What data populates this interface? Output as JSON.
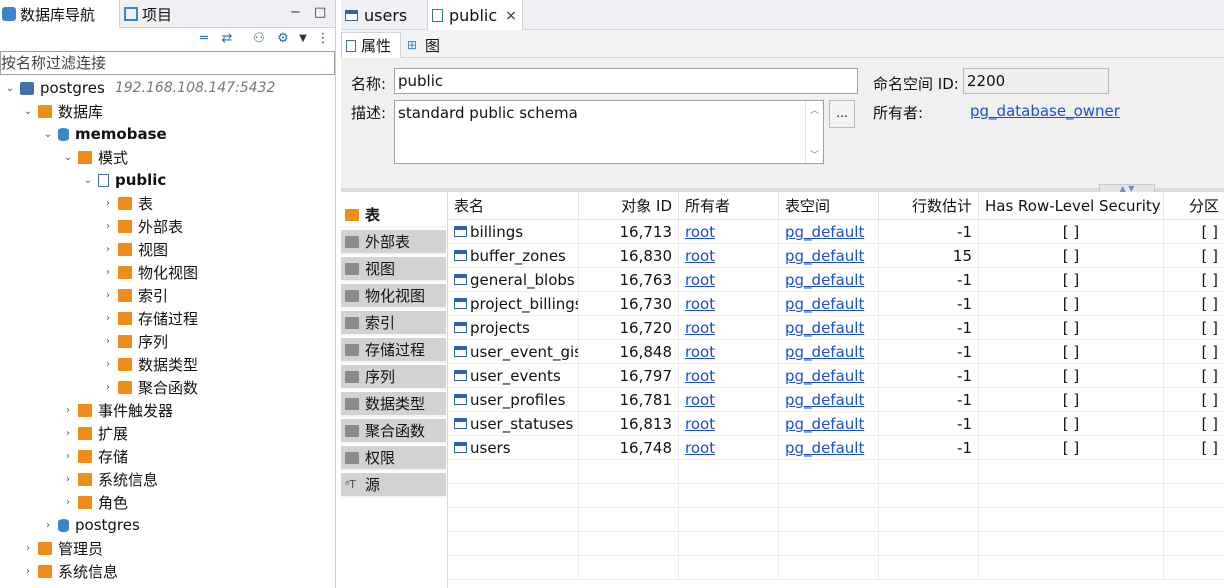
{
  "nav": {
    "tabs": [
      {
        "label": "数据库导航",
        "icon": "database-nav-icon"
      },
      {
        "label": "项目",
        "icon": "project-icon"
      }
    ],
    "minimize": "−",
    "maximize": "□",
    "filter_placeholder": "按名称过滤连接",
    "tree": {
      "connection": {
        "label": "postgres",
        "host": "192.168.108.147:5432"
      },
      "databases_label": "数据库",
      "db": {
        "label": "memobase"
      },
      "schemas_label": "模式",
      "schema": {
        "label": "public"
      },
      "schema_children": [
        "表",
        "外部表",
        "视图",
        "物化视图",
        "索引",
        "存储过程",
        "序列",
        "数据类型",
        "聚合函数"
      ],
      "db_children": [
        "事件触发器",
        "扩展",
        "存储",
        "系统信息",
        "角色"
      ],
      "other_db": "postgres",
      "admin": "管理员",
      "sysinfo": "系统信息"
    }
  },
  "editor": {
    "tabs": [
      {
        "label": "users"
      },
      {
        "label": "public",
        "close": "×"
      }
    ],
    "subtabs": [
      {
        "label": "属性"
      },
      {
        "label": "图"
      }
    ],
    "props": {
      "name_label": "名称:",
      "name_value": "public",
      "desc_label": "描述:",
      "desc_value": "standard public schema",
      "dots": "...",
      "ns_label": "命名空间 ID:",
      "ns_value": "2200",
      "owner_label": "所有者:",
      "owner_value": "pg_database_owner"
    },
    "folders": [
      "表",
      "外部表",
      "视图",
      "物化视图",
      "索引",
      "存储过程",
      "序列",
      "数据类型",
      "聚合函数",
      "权限",
      "源"
    ],
    "columns": [
      "表名",
      "对象 ID",
      "所有者",
      "表空间",
      "行数估计",
      "Has Row-Level Security",
      "分区"
    ],
    "rows": [
      {
        "name": "billings",
        "oid": "16,713",
        "owner": "root",
        "tablespace": "pg_default",
        "rows": "-1",
        "rls": "[ ]",
        "part": "[ ]"
      },
      {
        "name": "buffer_zones",
        "oid": "16,830",
        "owner": "root",
        "tablespace": "pg_default",
        "rows": "15",
        "rls": "[ ]",
        "part": "[ ]"
      },
      {
        "name": "general_blobs",
        "oid": "16,763",
        "owner": "root",
        "tablespace": "pg_default",
        "rows": "-1",
        "rls": "[ ]",
        "part": "[ ]"
      },
      {
        "name": "project_billings",
        "oid": "16,730",
        "owner": "root",
        "tablespace": "pg_default",
        "rows": "-1",
        "rls": "[ ]",
        "part": "[ ]"
      },
      {
        "name": "projects",
        "oid": "16,720",
        "owner": "root",
        "tablespace": "pg_default",
        "rows": "-1",
        "rls": "[ ]",
        "part": "[ ]"
      },
      {
        "name": "user_event_gists",
        "oid": "16,848",
        "owner": "root",
        "tablespace": "pg_default",
        "rows": "-1",
        "rls": "[ ]",
        "part": "[ ]"
      },
      {
        "name": "user_events",
        "oid": "16,797",
        "owner": "root",
        "tablespace": "pg_default",
        "rows": "-1",
        "rls": "[ ]",
        "part": "[ ]"
      },
      {
        "name": "user_profiles",
        "oid": "16,781",
        "owner": "root",
        "tablespace": "pg_default",
        "rows": "-1",
        "rls": "[ ]",
        "part": "[ ]"
      },
      {
        "name": "user_statuses",
        "oid": "16,813",
        "owner": "root",
        "tablespace": "pg_default",
        "rows": "-1",
        "rls": "[ ]",
        "part": "[ ]"
      },
      {
        "name": "users",
        "oid": "16,748",
        "owner": "root",
        "tablespace": "pg_default",
        "rows": "-1",
        "rls": "[ ]",
        "part": "[ ]"
      }
    ]
  }
}
